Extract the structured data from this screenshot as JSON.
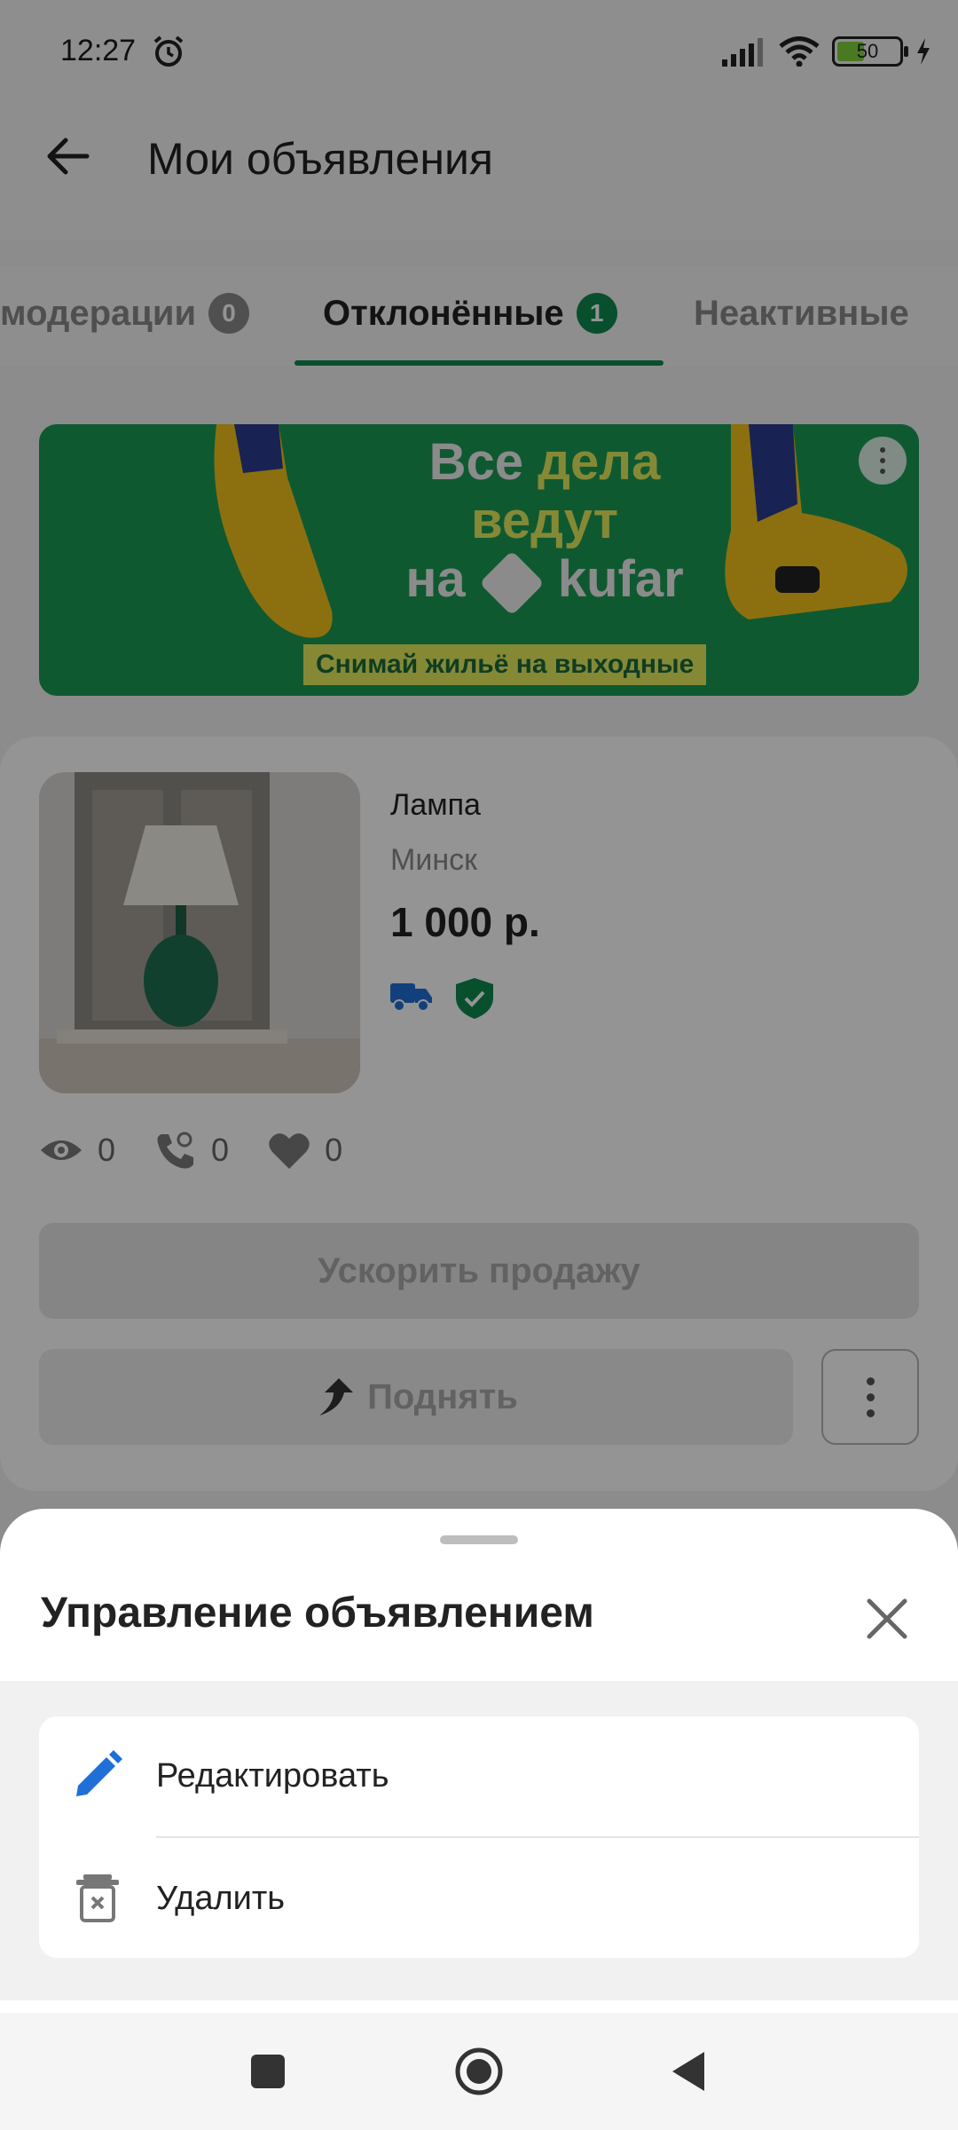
{
  "status": {
    "time": "12:27",
    "battery": "50"
  },
  "header": {
    "title": "Мои объявления"
  },
  "tabs": [
    {
      "label": "модерации",
      "count": "0"
    },
    {
      "label": "Отклонённые",
      "count": "1"
    },
    {
      "label": "Неактивные",
      "count": ""
    }
  ],
  "banner": {
    "line1": "Все",
    "line1b": "дела",
    "line2": "ведут",
    "line3a": "на",
    "line3b": "kufar",
    "caption": "Снимай жильё на выходные"
  },
  "listing": {
    "title": "Лампа",
    "city": "Минск",
    "price": "1 000 р.",
    "views": "0",
    "calls": "0",
    "likes": "0",
    "boost_label": "Ускорить продажу",
    "raise_label": "Поднять"
  },
  "sheet": {
    "title": "Управление объявлением",
    "items": [
      {
        "label": "Редактировать",
        "icon": "pencil-icon"
      },
      {
        "label": "Удалить",
        "icon": "trash-icon"
      }
    ]
  },
  "colors": {
    "accent": "#0f8a4f",
    "banner_bg": "#1b9a55",
    "banner_yellow": "#e6ec5d",
    "delivery_blue": "#1f6fd6"
  }
}
